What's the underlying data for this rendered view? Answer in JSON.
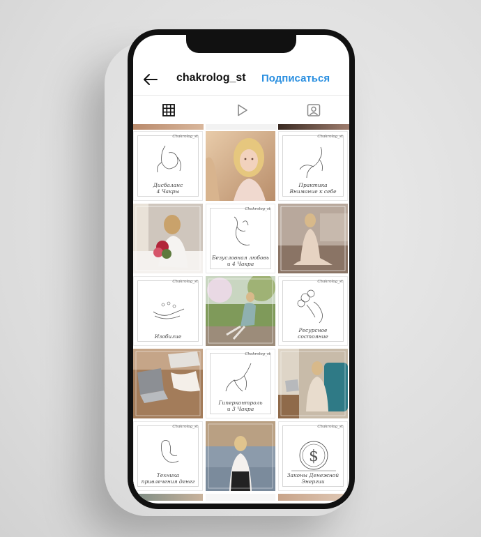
{
  "header": {
    "username": "chakrolog_st",
    "follow_label": "Подписаться"
  },
  "tabs": [
    {
      "name": "grid",
      "icon": "grid-icon",
      "active": true
    },
    {
      "name": "reels",
      "icon": "play-icon",
      "active": false
    },
    {
      "name": "tagged",
      "icon": "tagged-person-icon",
      "active": false
    }
  ],
  "brand": "Chakrolog_st",
  "posts": {
    "r1c1": {
      "caption": "Дисбаланс\n4 Чакры"
    },
    "r1c3": {
      "caption": "Практика\nВнимание к себе"
    },
    "r2c2": {
      "caption": "Безусловная любовь\nи 4 Чакра"
    },
    "r3c1": {
      "caption": "Изобилие"
    },
    "r3c3": {
      "caption": "Ресурсное\nсостояние"
    },
    "r4c2": {
      "caption": "Гиперконтроль\nи 3 Чакра"
    },
    "r5c1": {
      "caption": "Техника\nпривлечения денег"
    },
    "r5c3": {
      "caption": "Законы Денежной\nЭнергии"
    }
  },
  "colors": {
    "accent": "#2a8fe0",
    "phone": "#111111"
  }
}
